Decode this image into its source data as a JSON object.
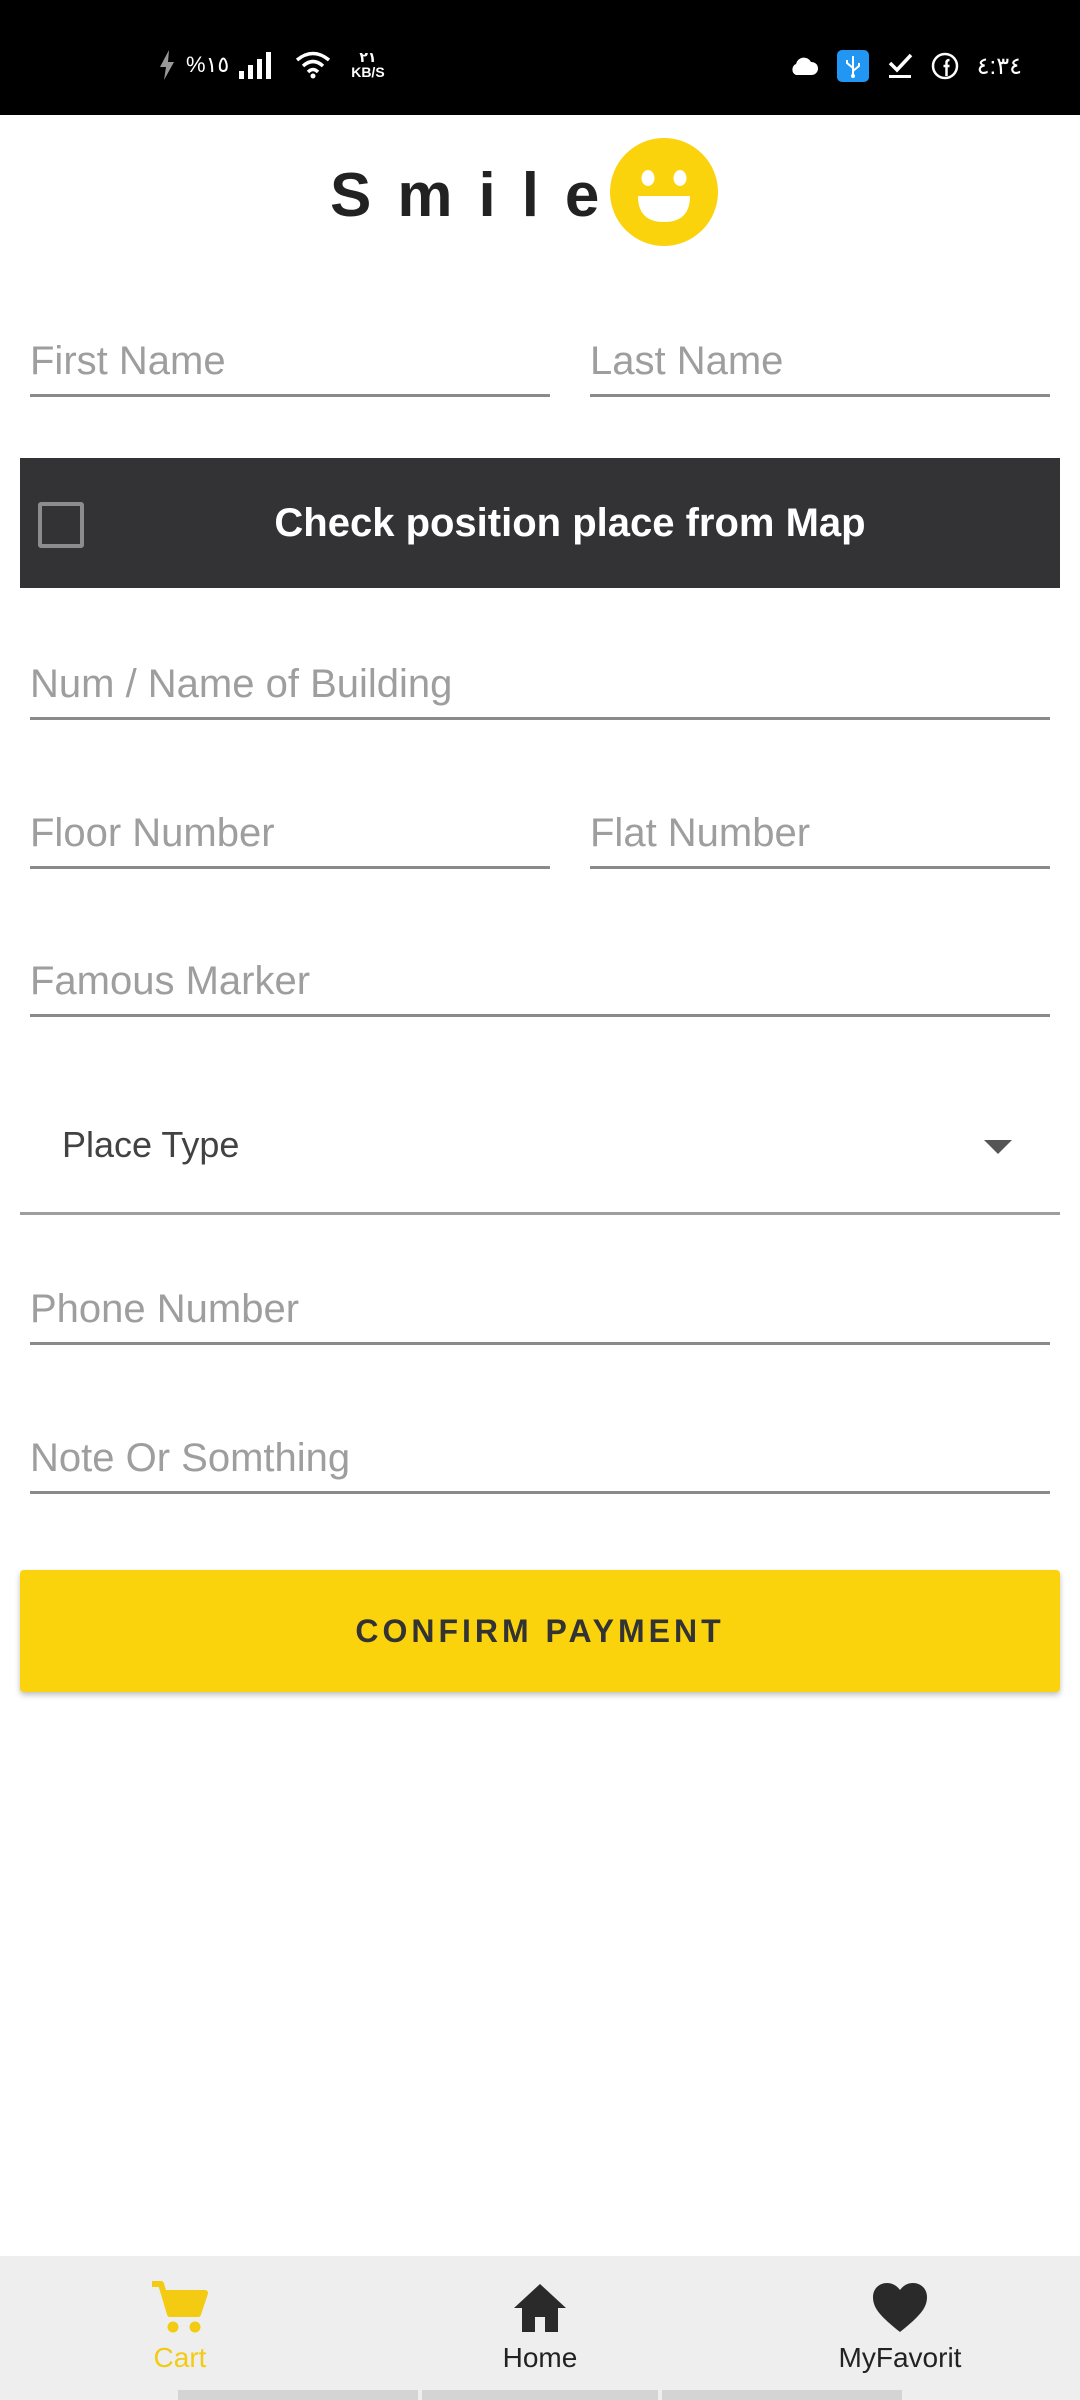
{
  "status_bar": {
    "battery": "%١٥",
    "net_speed_value": "٢١",
    "net_speed_unit": "KB/S",
    "time": "٤:٣٤",
    "icons": [
      "charging-icon",
      "signal-icon",
      "wifi-icon",
      "cloud-icon",
      "usb-icon",
      "check-icon",
      "facebook-icon"
    ]
  },
  "header": {
    "brand": "Smile",
    "logo_icon": "smiley-icon"
  },
  "form": {
    "first_name_placeholder": "First Name",
    "last_name_placeholder": "Last Name",
    "map_check_label": "Check position place from Map",
    "map_checked": false,
    "building_placeholder": "Num / Name of Building",
    "floor_placeholder": "Floor Number",
    "flat_placeholder": "Flat Number",
    "marker_placeholder": "Famous Marker",
    "place_type_label": "Place Type",
    "phone_placeholder": "Phone Number",
    "note_placeholder": "Note Or Somthing",
    "confirm_label": "CONFIRM PAYMENT"
  },
  "bottom_nav": {
    "items": [
      {
        "label": "Cart",
        "icon": "cart-icon",
        "active": true
      },
      {
        "label": "Home",
        "icon": "home-icon",
        "active": false
      },
      {
        "label": "MyFavorit",
        "icon": "heart-icon",
        "active": false
      }
    ]
  },
  "colors": {
    "accent": "#fad30c",
    "dark_bar": "#333336",
    "status_bar": "#000000",
    "nav_background": "#eeeeee"
  }
}
